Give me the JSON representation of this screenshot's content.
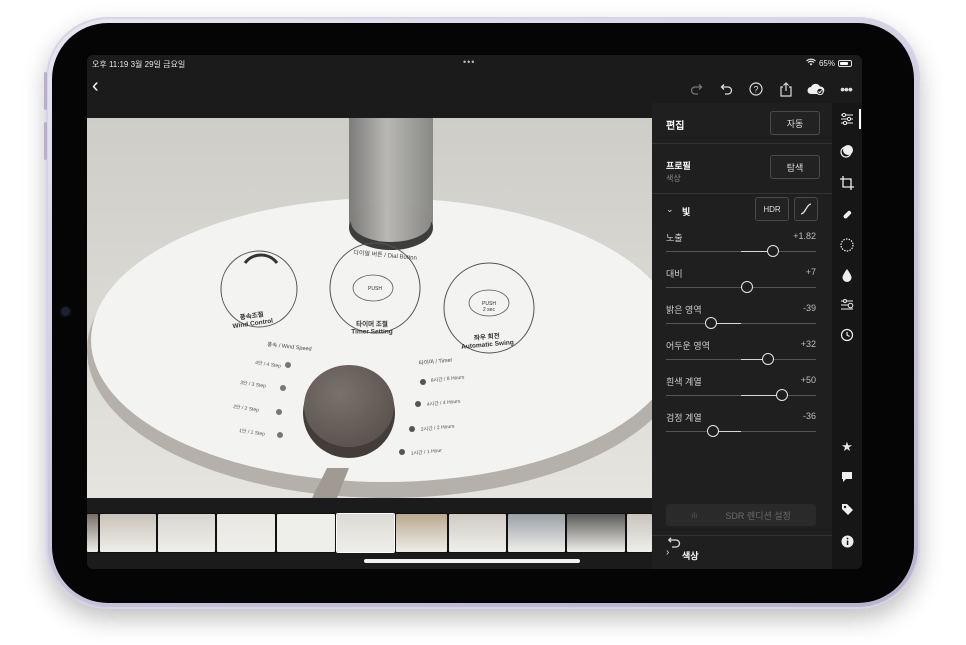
{
  "status_bar": {
    "time_date": "오후 11:19  3월 29일 금요일",
    "dots": "•••",
    "battery": "65%"
  },
  "toolbar": {
    "back": "‹",
    "icons": [
      "redo-icon",
      "undo-icon",
      "help-icon",
      "share-icon",
      "cloud-sync-icon",
      "more-icon"
    ]
  },
  "panel": {
    "edit_title": "편집",
    "auto_button": "자동",
    "profile_title": "프로필",
    "profile_value": "색상",
    "browse_button": "탐색",
    "light_section": "빛",
    "hdr_button": "HDR",
    "sliders": [
      {
        "label": "노출",
        "value": "+1.82",
        "position": 0.71
      },
      {
        "label": "대비",
        "value": "+7",
        "position": 0.54
      },
      {
        "label": "밝은 영역",
        "value": "-39",
        "position": 0.3
      },
      {
        "label": "어두운 영역",
        "value": "+32",
        "position": 0.68
      },
      {
        "label": "흰색 계열",
        "value": "+50",
        "position": 0.77
      },
      {
        "label": "검정 계열",
        "value": "-36",
        "position": 0.31
      }
    ],
    "sdr_button": "SDR 렌디션 설정",
    "color_section": "색상"
  },
  "photo": {
    "dial_label": "다이얼 버튼 / Dial Button",
    "wind_control": "풍속조절\nWind Control",
    "timer_setting": "타이머 조절\nTimer Setting",
    "automatic_swing": "좌우 회전\nAutomatic Swing",
    "push": "PUSH",
    "push_2sec": "PUSH\n2 sec",
    "wind_speed": "풍속 / Wind Speed",
    "timer": "타이머 / Timer",
    "speeds": [
      "4단 / 4 Step",
      "3단 / 3 Step",
      "2단 / 2 Step",
      "1단 / 1 Step"
    ],
    "hours": [
      "8시간 / 8 Hours",
      "4시간 / 4 Hours",
      "2시간 / 2 Hours",
      "1시간 / 1 Hour"
    ]
  },
  "filmstrip": {
    "thumbs": [
      "#7a6f66",
      "#c9c2b8",
      "#d8d6cf",
      "#e9e7e2",
      "#eeeeea",
      "#dcdad5",
      "#b9a98f",
      "#d0ccc4",
      "#9aa0a6",
      "#5b5a58",
      "#c8c4bd"
    ]
  },
  "colors": {
    "panel_bg": "#1f1f1f",
    "accent": "#ffffff",
    "device": "#cfc9df"
  }
}
